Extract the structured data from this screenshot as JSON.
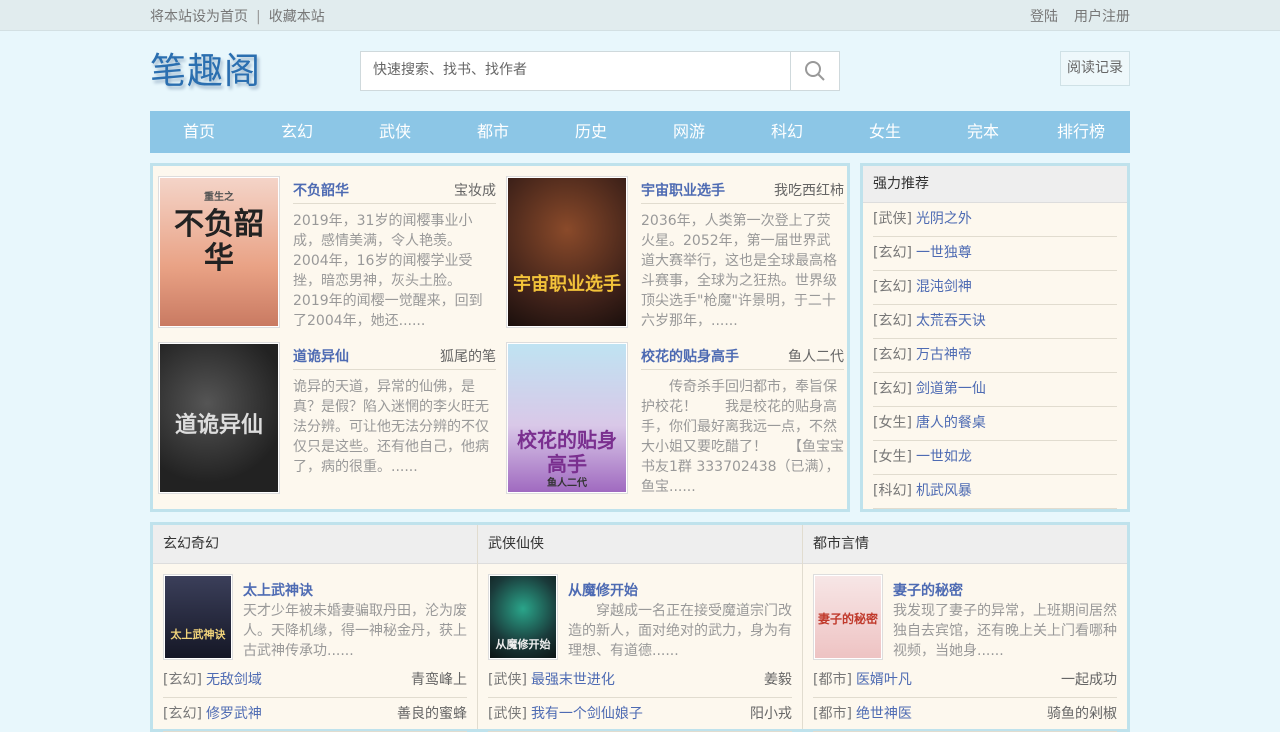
{
  "topbar": {
    "set_home": "将本站设为首页",
    "separator": "|",
    "bookmark": "收藏本站",
    "login": "登陆",
    "register": "用户注册"
  },
  "header": {
    "logo": "笔趣阁",
    "search_placeholder": "快速搜索、找书、找作者",
    "history": "阅读记录"
  },
  "nav": [
    "首页",
    "玄幻",
    "武侠",
    "都市",
    "历史",
    "网游",
    "科幻",
    "女生",
    "完本",
    "排行榜"
  ],
  "featured": [
    {
      "title": "不负韶华",
      "author": "宝妆成",
      "desc": "2019年，31岁的闻樱事业小成，感情美满，令人艳羡。2004年，16岁的闻樱学业受挫，暗恋男神，灰头土脸。2019年的闻樱一觉醒来，回到了2004年，她还......",
      "cover_text": "不负韶华",
      "cover_sub": "重生之"
    },
    {
      "title": "宇宙职业选手",
      "author": "我吃西红柿",
      "desc": "2036年，人类第一次登上了荧火星。2052年，第一届世界武道大赛举行，这也是全球最高格斗赛事，全球为之狂热。世界级顶尖选手\"枪魔\"许景明，于二十六岁那年，......",
      "cover_text": "宇宙职业选手",
      "cover_sub": ""
    },
    {
      "title": "道诡异仙",
      "author": "狐尾的笔",
      "desc": "诡异的天道，异常的仙佛，是真？是假？陷入迷惘的李火旺无法分辨。可让他无法分辨的不仅仅只是这些。还有他自己，他病了，病的很重。......",
      "cover_text": "道诡异仙",
      "cover_sub": ""
    },
    {
      "title": "校花的贴身高手",
      "author": "鱼人二代",
      "desc": "　　传奇杀手回归都市，奉旨保护校花！　　我是校花的贴身高手，你们最好离我远一点，不然大小姐又要吃醋了！　　【鱼宝宝书友1群 333702438（已满），鱼宝......",
      "cover_text": "校花的贴身高手",
      "cover_sub": "鱼人二代"
    }
  ],
  "recommend": {
    "title": "强力推荐",
    "items": [
      {
        "cat": "[武侠]",
        "name": "光阴之外"
      },
      {
        "cat": "[玄幻]",
        "name": "一世独尊"
      },
      {
        "cat": "[玄幻]",
        "name": "混沌剑神"
      },
      {
        "cat": "[玄幻]",
        "name": "太荒吞天诀"
      },
      {
        "cat": "[玄幻]",
        "name": "万古神帝"
      },
      {
        "cat": "[玄幻]",
        "name": "剑道第一仙"
      },
      {
        "cat": "[女生]",
        "name": "唐人的餐桌"
      },
      {
        "cat": "[女生]",
        "name": "一世如龙"
      },
      {
        "cat": "[科幻]",
        "name": "机武风暴"
      }
    ]
  },
  "columns": [
    {
      "title": "玄幻奇幻",
      "book": {
        "title": "太上武神诀",
        "desc": "天才少年被未婚妻骗取丹田，沦为废人。天降机缘，得一神秘金丹，获上古武神传承功......",
        "cover_text": "太上武神诀"
      },
      "list": [
        {
          "cat": "[玄幻]",
          "name": "无敌剑域",
          "author": "青鸾峰上"
        },
        {
          "cat": "[玄幻]",
          "name": "修罗武神",
          "author": "善良的蜜蜂"
        }
      ]
    },
    {
      "title": "武侠仙侠",
      "book": {
        "title": "从魔修开始",
        "desc": "　　穿越成一名正在接受魔道宗门改造的新人，面对绝对的武力，身为有理想、有道德......",
        "cover_text": "从魔修开始"
      },
      "list": [
        {
          "cat": "[武侠]",
          "name": "最强末世进化",
          "author": "姜毅"
        },
        {
          "cat": "[武侠]",
          "name": "我有一个剑仙娘子",
          "author": "阳小戎"
        }
      ]
    },
    {
      "title": "都市言情",
      "book": {
        "title": "妻子的秘密",
        "desc": "我发现了妻子的异常，上班期间居然独自去宾馆，还有晚上关上门看哪种视频，当她身......",
        "cover_text": "妻子的秘密"
      },
      "list": [
        {
          "cat": "[都市]",
          "name": "医婿叶凡",
          "author": "一起成功"
        },
        {
          "cat": "[都市]",
          "name": "绝世神医",
          "author": "骑鱼的剁椒"
        }
      ]
    }
  ]
}
